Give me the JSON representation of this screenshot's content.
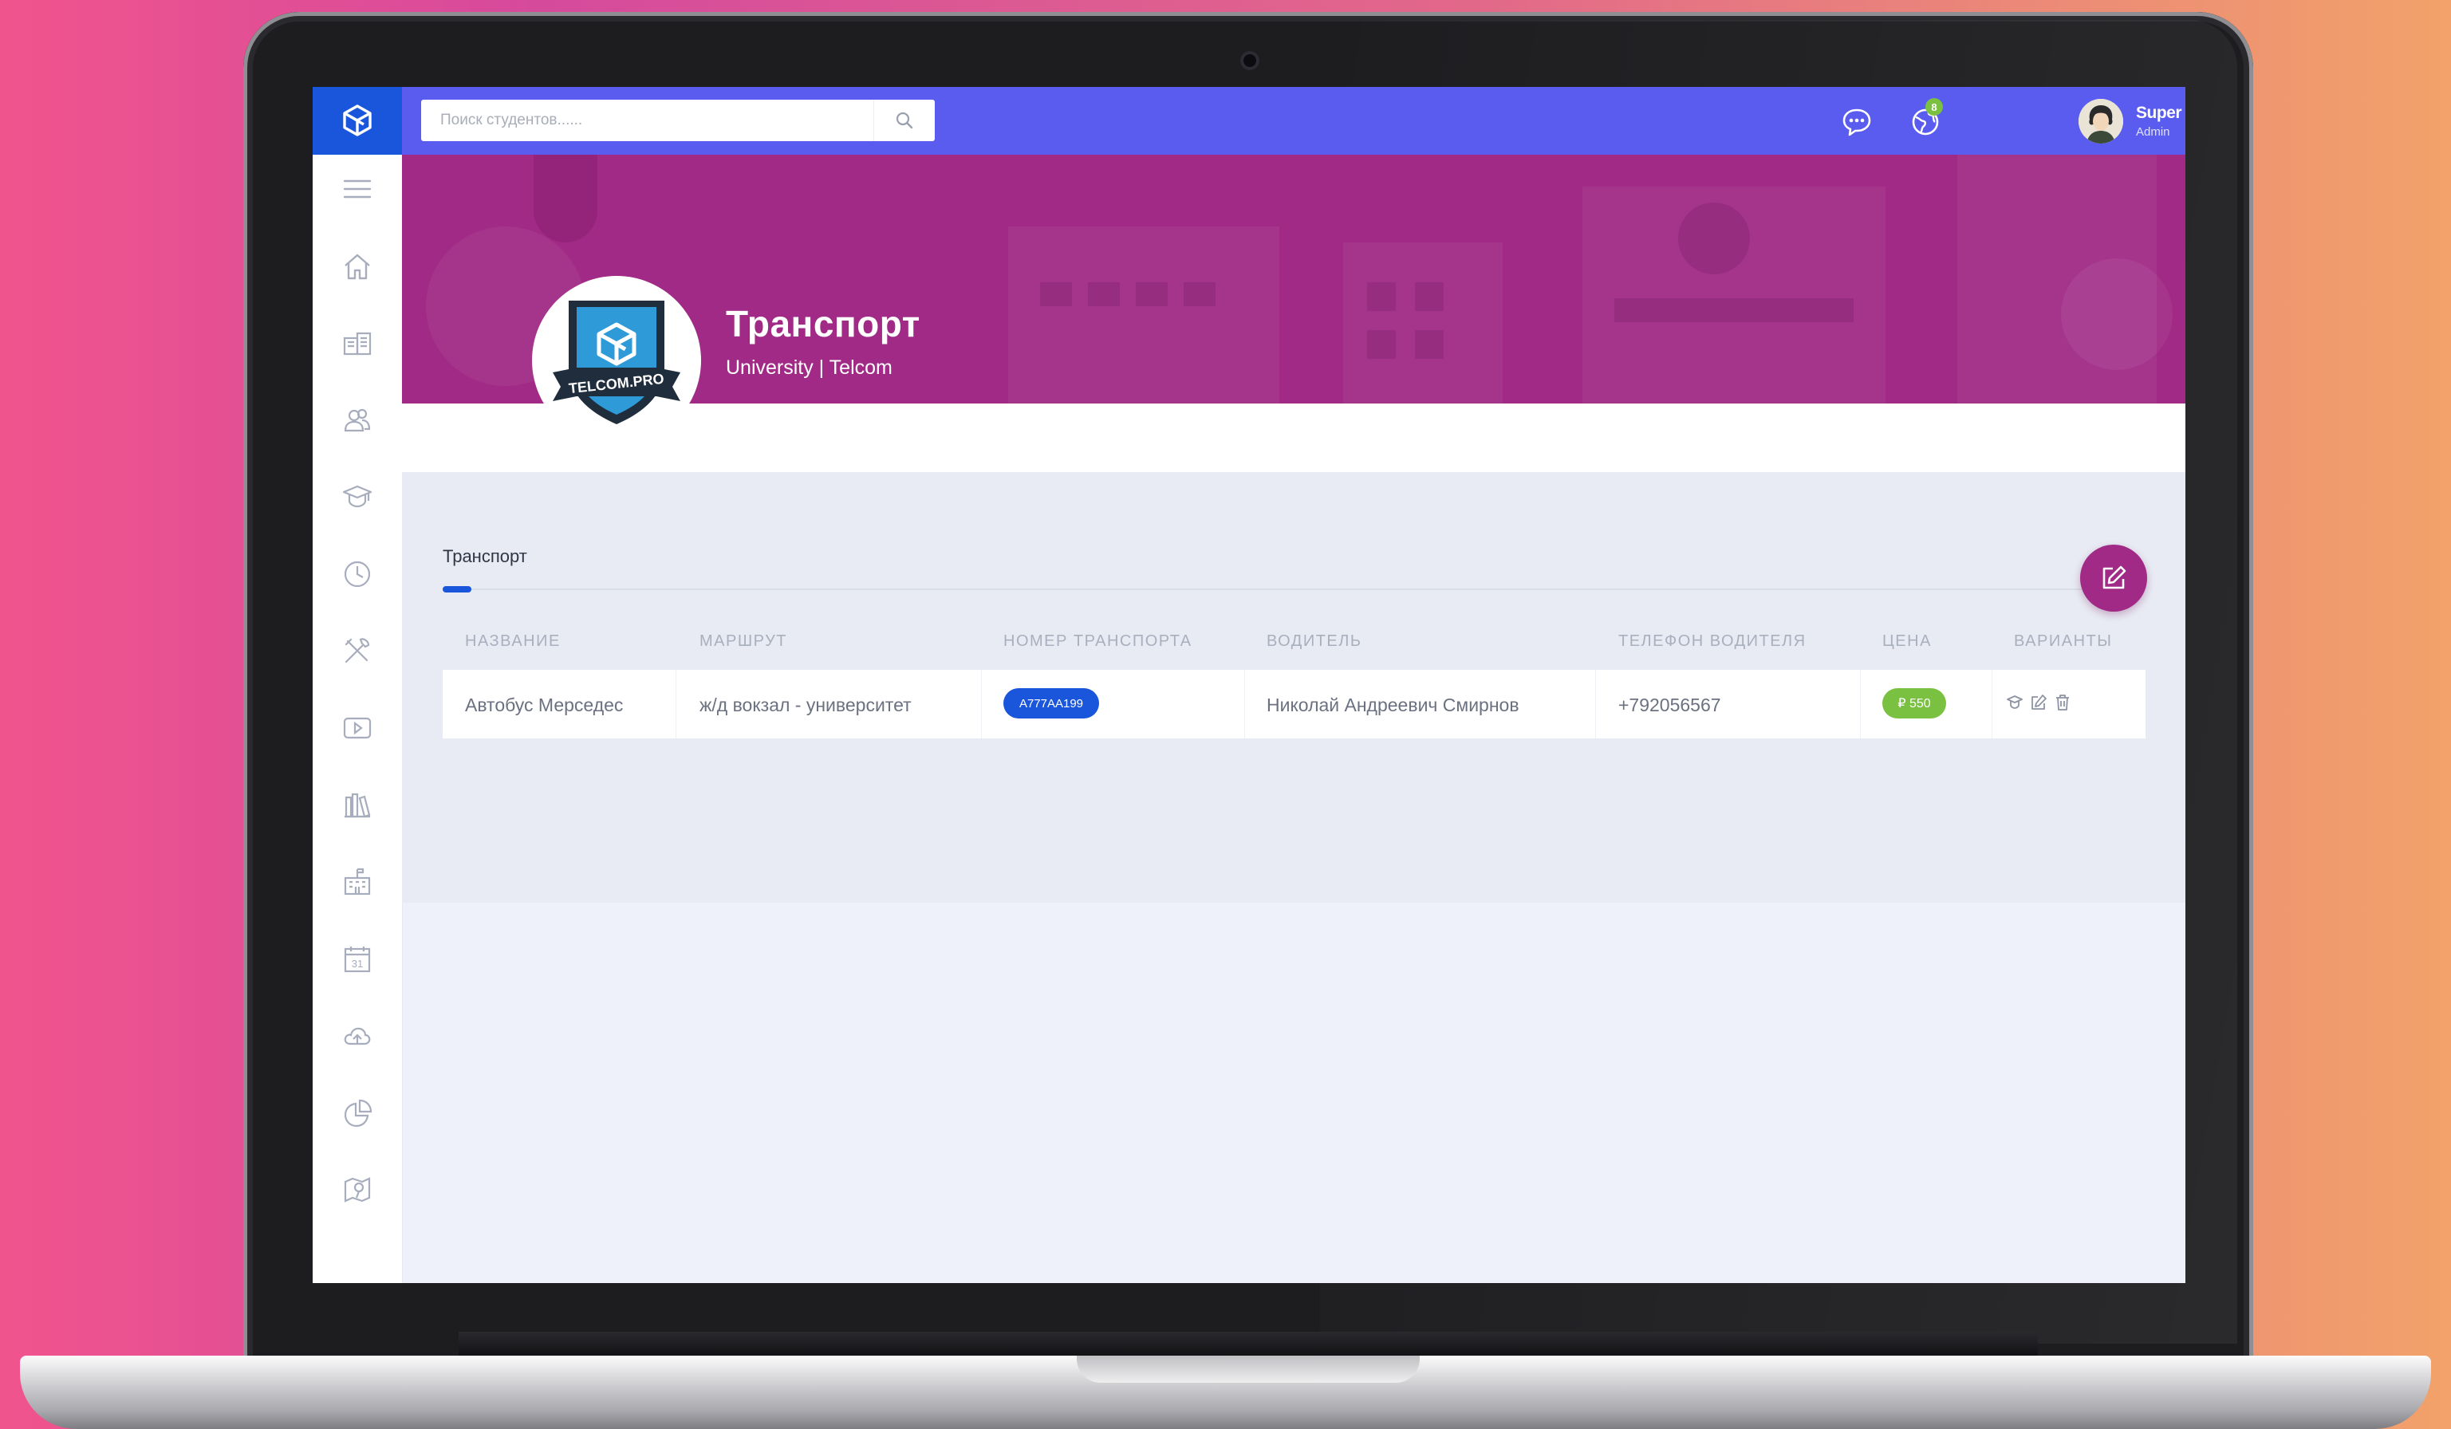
{
  "colors": {
    "topbar": "#5a5cf0",
    "brand": "#1a56db",
    "banner": "#a02a85",
    "plate_badge": "#1a56db",
    "price_badge": "#7ac142",
    "notification_badge": "#7ac142"
  },
  "search": {
    "placeholder": "Поиск студентов......",
    "icon": "search-icon"
  },
  "header": {
    "icons": [
      "chat-icon",
      "globe-icon"
    ],
    "notification_count": "8",
    "user": {
      "name": "Super Admin",
      "role": "Admin"
    }
  },
  "sidebar": {
    "icons": [
      "menu-icon",
      "home-icon",
      "news-icon",
      "users-icon",
      "graduation-cap-icon",
      "clock-icon",
      "tools-icon",
      "video-icon",
      "library-icon",
      "school-icon",
      "calendar-icon",
      "cloud-icon",
      "chart-icon",
      "map-icon"
    ],
    "calendar_day": "31"
  },
  "banner": {
    "title": "Транспорт",
    "subtitle": "University | Telcom",
    "logo_text": "TELCOM.PRO"
  },
  "section": {
    "title": "Транспорт"
  },
  "table": {
    "headers": [
      "НАЗВАНИЕ",
      "МАРШРУТ",
      "НОМЕР ТРАНСПОРТА",
      "ВОДИТЕЛЬ",
      "ТЕЛЕФОН ВОДИТЕЛЯ",
      "ЦЕНА",
      "ВАРИАНТЫ"
    ],
    "rows": [
      {
        "name": "Автобус Мерседес",
        "route": "ж/д вокзал - университет",
        "plate": "A777AA199",
        "driver": "Николай Андреевич Смирнов",
        "phone": "+792056567",
        "price": "₽ 550",
        "actions": [
          "student-icon",
          "edit-icon",
          "trash-icon"
        ]
      }
    ]
  }
}
